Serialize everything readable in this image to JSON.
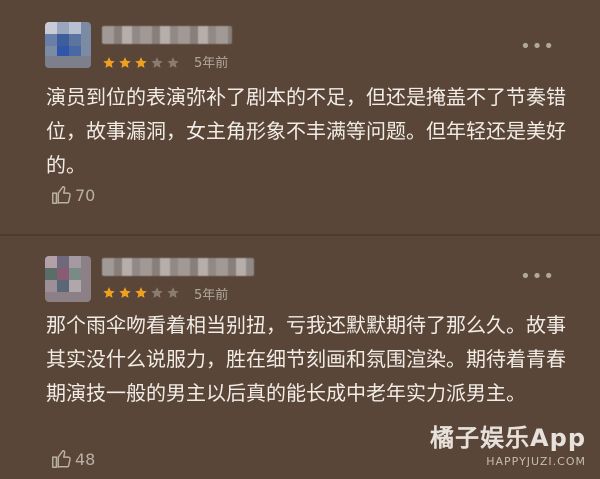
{
  "reviews": [
    {
      "rating": 3,
      "rating_max": 5,
      "time": "5年前",
      "content": "演员到位的表演弥补了剧本的不足，但还是掩盖不了节奏错位，故事漏洞，女主角形象不丰满等问题。但年轻还是美好的。",
      "likes": "70"
    },
    {
      "rating": 3,
      "rating_max": 5,
      "time": "5年前",
      "content": "那个雨伞吻看着相当别扭，亏我还默默期待了那么久。故事其实没什么说服力，胜在细节刻画和氛围渲染。期待着青春期演技一般的男主以后真的能长成中老年实力派男主。",
      "likes": "48"
    }
  ],
  "more_label": "•••",
  "watermark": {
    "title": "橘子娱乐App",
    "url": "HAPPYJUZI.COM"
  },
  "colors": {
    "background": "#5a4638",
    "star_filled": "#f0a020",
    "star_empty": "#8a7b70",
    "text": "#f1ece6",
    "muted": "#b0a89e"
  }
}
